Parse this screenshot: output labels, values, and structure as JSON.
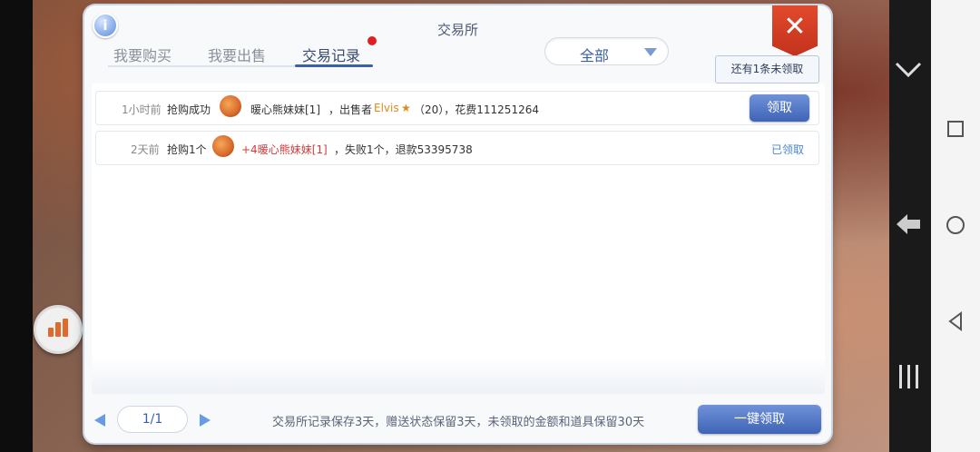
{
  "window": {
    "title": "交易所",
    "info_icon": "i",
    "close_icon": "✕"
  },
  "tabs": [
    {
      "label": "我要购买",
      "active": false
    },
    {
      "label": "我要出售",
      "active": false
    },
    {
      "label": "交易记录",
      "active": true,
      "has_notification": true
    }
  ],
  "filter": {
    "selected": "全部"
  },
  "unclaimed_tip": "还有1条未领取",
  "records": [
    {
      "time": "1小时前",
      "action": "抢购成功",
      "item": "暖心熊妹妹[1]",
      "detail_prefix": "，出售者",
      "seller": "Elvis",
      "seller_star": "★",
      "detail_suffix": "（20），花费111251264",
      "button": "领取"
    },
    {
      "time": "2天前",
      "action": "抢购1个",
      "item": "+4暖心熊妹妹[1]",
      "detail_suffix": "，失败1个，退款53395738",
      "status": "已领取"
    }
  ],
  "footer": {
    "page": "1/1",
    "note": "交易所记录保存3天，赠送状态保留3天，未领取的金额和道具保留30天",
    "claim_all": "一键领取"
  },
  "colors": {
    "accent": "#3c5fa9",
    "seller": "#e08a1a",
    "enhanced_item": "#d43a3a",
    "close": "#d23a24"
  }
}
